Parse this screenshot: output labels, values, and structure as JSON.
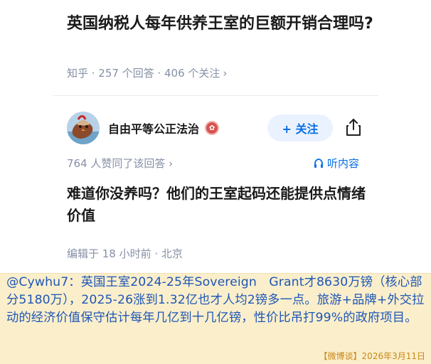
{
  "question": {
    "title": "英国纳税人每年供养王室的巨额开销合理吗?",
    "meta": "知乎 · 257 个回答 · 406 个关注",
    "chevron": "›"
  },
  "answer": {
    "author_name": "自由平等公正法治",
    "follow_label": "+ 关注",
    "vote_meta": "764 人赞同了该回答 ›",
    "listen_label": "听内容",
    "body": "难道你没养吗？他们的王室起码还能提供点情绪价值",
    "edit_meta": "编辑于 18 小时前 · 北京"
  },
  "comment": {
    "text": "@Cywhu7：英国王室2024-25年Sovereign　Grant才8630万镑（核心部分5180万），2025-26涨到1.32亿也才人均2镑多一点。旅游+品牌+外交拉动的经济价值保守估计每年几亿到十几亿镑，性价比吊打99%的政府项目。",
    "source": "【微博谈】2026年3月11日"
  },
  "colors": {
    "accent": "#056de8",
    "meta_gray": "#8590a6",
    "comment_bg": "#fbefcb",
    "comment_text": "#1e56b8",
    "source_text": "#c9851a"
  },
  "icons": {
    "avatar": "avatar-image",
    "badge": "verified-badge-icon",
    "share": "share-icon",
    "listen": "headphones-icon"
  }
}
